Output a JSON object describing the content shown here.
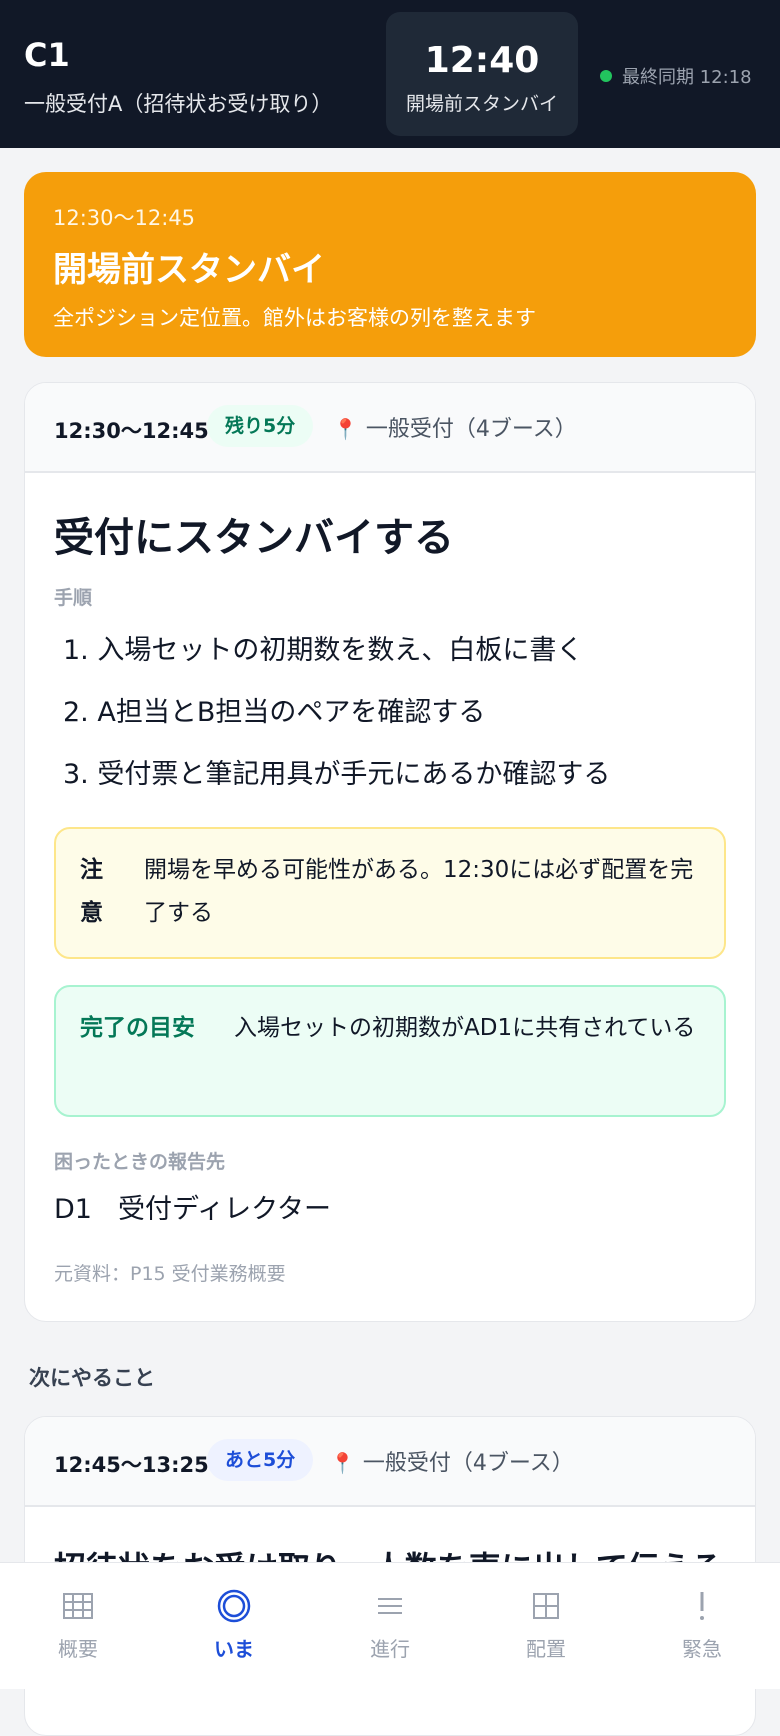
{
  "header": {
    "role": "C1",
    "position": "一般受付A（招待状お受け取り）",
    "clock_time": "12:40",
    "clock_phase": "開場前スタンバイ",
    "sync_text": "最終同期 12:18",
    "sync_status_color": "#22c55e"
  },
  "phase_banner": {
    "time": "12:30〜12:45",
    "title": "開場前スタンバイ",
    "description": "全ポジション定位置。館外はお客様の列を整えます",
    "color": "#f59e0b"
  },
  "current_task": {
    "time": "12:30〜12:45",
    "remaining": "残り5分",
    "location": "一般受付（4ブース）",
    "title": "受付にスタンバイする",
    "steps_label": "手順",
    "steps": [
      "1. 入場セットの初期数を数え、白板に書く",
      "2. A担当とB担当のペアを確認する",
      "3. 受付票と筆記用具が手元にあるか確認する"
    ],
    "caution_label": "注意",
    "caution_text": "開場を早める可能性がある。12:30には必ず配置を完了する",
    "done_label": "完了の目安",
    "done_text": "入場セットの初期数がAD1に共有されている",
    "report_label": "困ったときの報告先",
    "report_code": "D1",
    "report_name": "受付ディレクター",
    "source": "元資料：P15 受付業務概要"
  },
  "next_section_label": "次にやること",
  "next_task": {
    "time": "12:45〜13:25",
    "until": "あと5分",
    "location": "一般受付（4ブース）",
    "title": "招待状をお受け取り、人数を声に出して伝える"
  },
  "tabs": [
    {
      "label": "概要",
      "icon": "grid-icon"
    },
    {
      "label": "いま",
      "icon": "target-icon"
    },
    {
      "label": "進行",
      "icon": "list-icon"
    },
    {
      "label": "配置",
      "icon": "layout-icon"
    },
    {
      "label": "緊急",
      "icon": "alert-icon"
    }
  ],
  "active_tab_color": "#1d4ed8"
}
